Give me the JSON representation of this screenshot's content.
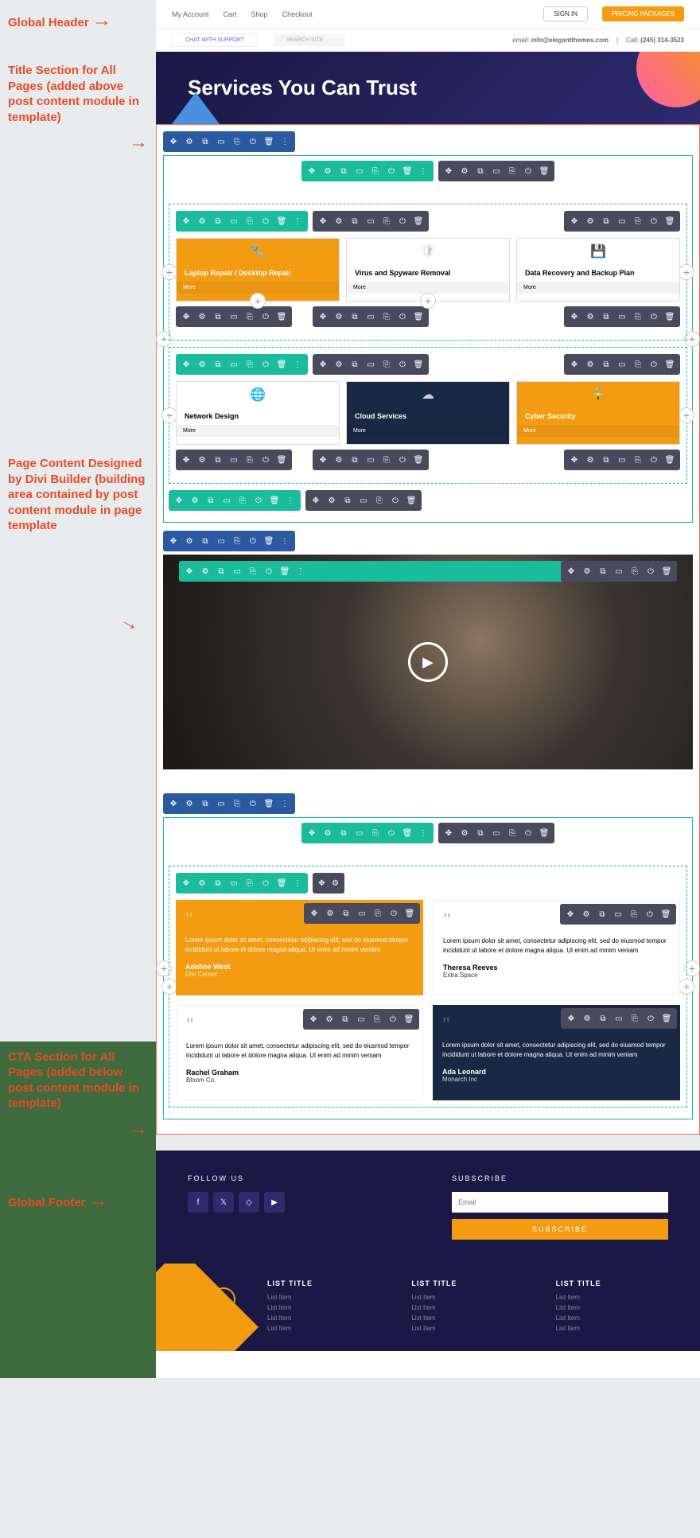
{
  "annotations": {
    "header": "Global Header",
    "title_section": "Title Section for All Pages (added above post content module in template)",
    "page_content": "Page Content Designed by Divi Builder (building area contained by post content module in page template",
    "cta_section": "CTA Section for All Pages (added below post content module in template)",
    "footer": "Global Footer"
  },
  "topbar": {
    "my_account": "My Account",
    "cart": "Cart",
    "shop": "Shop",
    "checkout": "Checkout",
    "signin": "SIGN IN",
    "pricing": "PRICING PACKAGES"
  },
  "subbar": {
    "chat": "CHAT WITH SUPPORT",
    "search_placeholder": "SEARCH SITE",
    "email_label": "email:",
    "email": "info@elegantthemes.com",
    "call_label": "Call:",
    "phone": "(245) 314-3523"
  },
  "hero": {
    "title": "Services You Can Trust"
  },
  "toolbar_icons": [
    "✥",
    "⚙",
    "⧉",
    "▭",
    "⎘",
    "⏻",
    "🗑",
    "⋮"
  ],
  "services": {
    "row1": [
      {
        "title": "Laptop Repair / Desktop Repair",
        "more": "More"
      },
      {
        "title": "Virus and Spyware Removal",
        "more": "More"
      },
      {
        "title": "Data Recovery and Backup Plan",
        "more": "More"
      }
    ],
    "row2": [
      {
        "title": "Network Design",
        "more": "More"
      },
      {
        "title": "Cloud Services",
        "more": "More"
      },
      {
        "title": "Cyber Security",
        "more": "More"
      }
    ]
  },
  "testimonials": [
    {
      "text": "Lorem ipsum dolor sit amet, consectetur adipiscing elit, sed do eiusmod tempor incididunt ut labore et dolore magna aliqua. Ut enim ad minim veniam",
      "name": "Adeline West",
      "company": "Divi Corner"
    },
    {
      "text": "Lorem ipsum dolor sit amet, consectetur adipiscing elit, sed do eiusmod tempor incididunt ut labore et dolore magna aliqua. Ut enim ad minim veniam",
      "name": "Theresa Reeves",
      "company": "Extra Space"
    },
    {
      "text": "Lorem ipsum dolor sit amet, consectetur adipiscing elit, sed do eiusmod tempor incididunt ut labore et dolore magna aliqua. Ut enim ad minim veniam",
      "name": "Rachel Graham",
      "company": "Bloom Co."
    },
    {
      "text": "Lorem ipsum dolor sit amet, consectetur adipiscing elit, sed do eiusmod tempor incididunt ut labore et dolore magna aliqua. Ut enim ad minim veniam",
      "name": "Ada Leonard",
      "company": "Monarch Inc"
    }
  ],
  "cta": {
    "follow": "FOLLOW US",
    "subscribe_title": "SUBSCRIBE",
    "email_placeholder": "Email",
    "subscribe_btn": "SUBSCRIBE"
  },
  "footer": {
    "list_title": "LIST TITLE",
    "list_item": "List Item"
  }
}
